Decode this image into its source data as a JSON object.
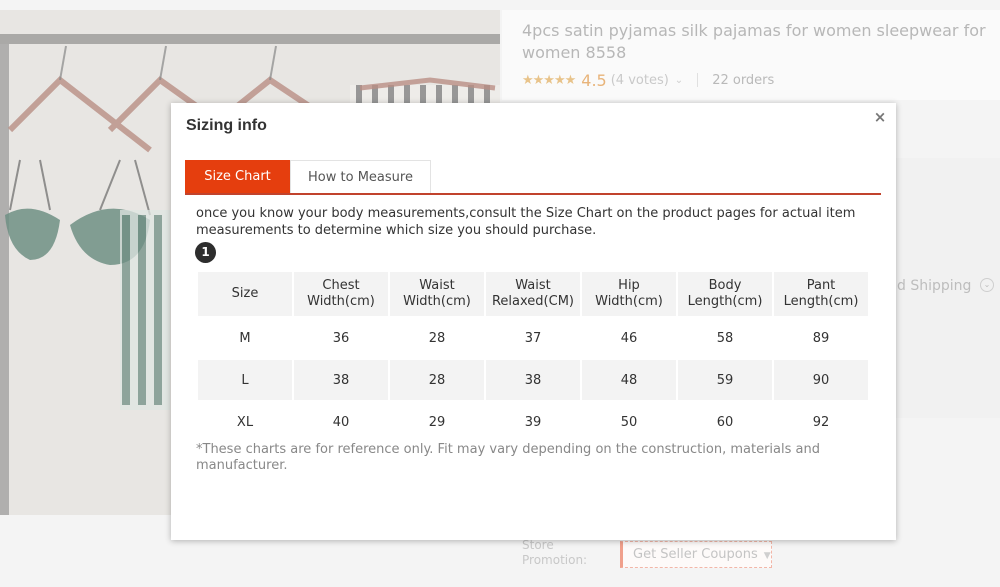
{
  "background": {
    "product_title": "4pcs satin pyjamas silk pajamas for women sleepwear for women 8558",
    "rating": {
      "stars_icon": "star-rating-icon",
      "stars": "★★★★★",
      "score": "4.5",
      "votes": "(4 votes)",
      "caret": "⌄"
    },
    "orders": "22 orders",
    "shipping_text": "d Shipping",
    "shipping_chevron": "⌄",
    "store_promotion_label": "Store Promotion:",
    "coupon_button": "Get Seller Coupons",
    "coupon_caret": "▼"
  },
  "modal": {
    "title": "Sizing info",
    "close_icon": "×",
    "tabs": [
      {
        "label": "Size Chart",
        "active": true
      },
      {
        "label": "How to Measure",
        "active": false
      }
    ],
    "intro": "once you know your body measurements,consult the Size Chart on the product pages for actual item measurements to determine which size you should purchase.",
    "step_badge": "1",
    "table": {
      "headers": [
        "Size",
        "Chest Width(cm)",
        "Waist Width(cm)",
        "Waist Relaxed(CM)",
        "Hip Width(cm)",
        "Body Length(cm)",
        "Pant Length(cm)"
      ],
      "rows": [
        [
          "M",
          "36",
          "28",
          "37",
          "46",
          "58",
          "89"
        ],
        [
          "L",
          "38",
          "28",
          "38",
          "48",
          "59",
          "90"
        ],
        [
          "XL",
          "40",
          "29",
          "39",
          "50",
          "60",
          "92"
        ]
      ]
    },
    "disclaimer": "*These charts are for reference only. Fit may vary depending on the construction, materials and manufacturer."
  },
  "colors": {
    "accent": "#e53e0e",
    "tab_underline": "#c1432d",
    "table_shade": "#f3f3f3"
  }
}
